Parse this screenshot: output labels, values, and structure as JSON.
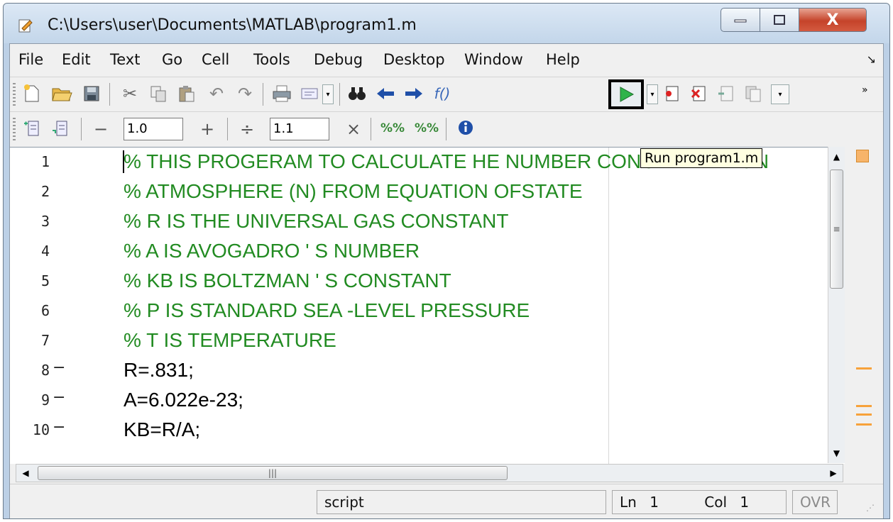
{
  "window": {
    "title": "C:\\Users\\user\\Documents\\MATLAB\\program1.m",
    "close_glyph": "X"
  },
  "menu": {
    "items": [
      "File",
      "Edit",
      "Text",
      "Go",
      "Cell",
      "Tools",
      "Debug",
      "Desktop",
      "Window",
      "Help"
    ]
  },
  "toolbar2": {
    "decrement": "−",
    "cell_value1": "1.0",
    "increment": "+",
    "divide": "÷",
    "cell_value2": "1.1",
    "multiply": "×"
  },
  "tooltip": {
    "text": "Run program1.m"
  },
  "editor": {
    "lines": [
      {
        "num": "1",
        "bp": "",
        "text": "% THIS PROGERAM TO CALCULATE HE NUMBER CONCENTRATION",
        "type": "comment"
      },
      {
        "num": "2",
        "bp": "",
        "text": "% ATMOSPHERE (N) FROM EQUATION OFSTATE",
        "type": "comment"
      },
      {
        "num": "3",
        "bp": "",
        "text": "% R IS THE UNIVERSAL GAS CONSTANT",
        "type": "comment"
      },
      {
        "num": "4",
        "bp": "",
        "text": "% A IS AVOGADRO ' S NUMBER",
        "type": "comment"
      },
      {
        "num": "5",
        "bp": "",
        "text": "% KB IS BOLTZMAN ' S CONSTANT",
        "type": "comment"
      },
      {
        "num": "6",
        "bp": "",
        "text": "% P IS STANDARD SEA -LEVEL PRESSURE",
        "type": "comment"
      },
      {
        "num": "7",
        "bp": "",
        "text": "% T IS TEMPERATURE",
        "type": "comment"
      },
      {
        "num": "8",
        "bp": "−",
        "text": "R=.831;",
        "type": "stmt"
      },
      {
        "num": "9",
        "bp": "−",
        "text": "A=6.022e-23;",
        "type": "stmt"
      },
      {
        "num": "10",
        "bp": "−",
        "text": "KB=R/A;",
        "type": "stmt"
      }
    ]
  },
  "status": {
    "mode": "script",
    "ln_label": "Ln",
    "ln_value": "1",
    "col_label": "Col",
    "col_value": "1",
    "ovr": "OVR"
  },
  "icons": [
    "new-file-icon",
    "open-folder-icon",
    "save-icon",
    "cut-icon",
    "copy-icon",
    "paste-icon",
    "undo-icon",
    "redo-icon",
    "print-icon",
    "comment-icon",
    "find-icon",
    "back-arrow-icon",
    "forward-arrow-icon",
    "function-icon",
    "run-icon",
    "breakpoint-set-icon",
    "breakpoint-clear-icon",
    "step-icon",
    "step-in-icon",
    "insert-cell-icon",
    "eval-cell-icon",
    "show-cell-titles-icon",
    "show-cell-help-icon",
    "info-icon"
  ]
}
